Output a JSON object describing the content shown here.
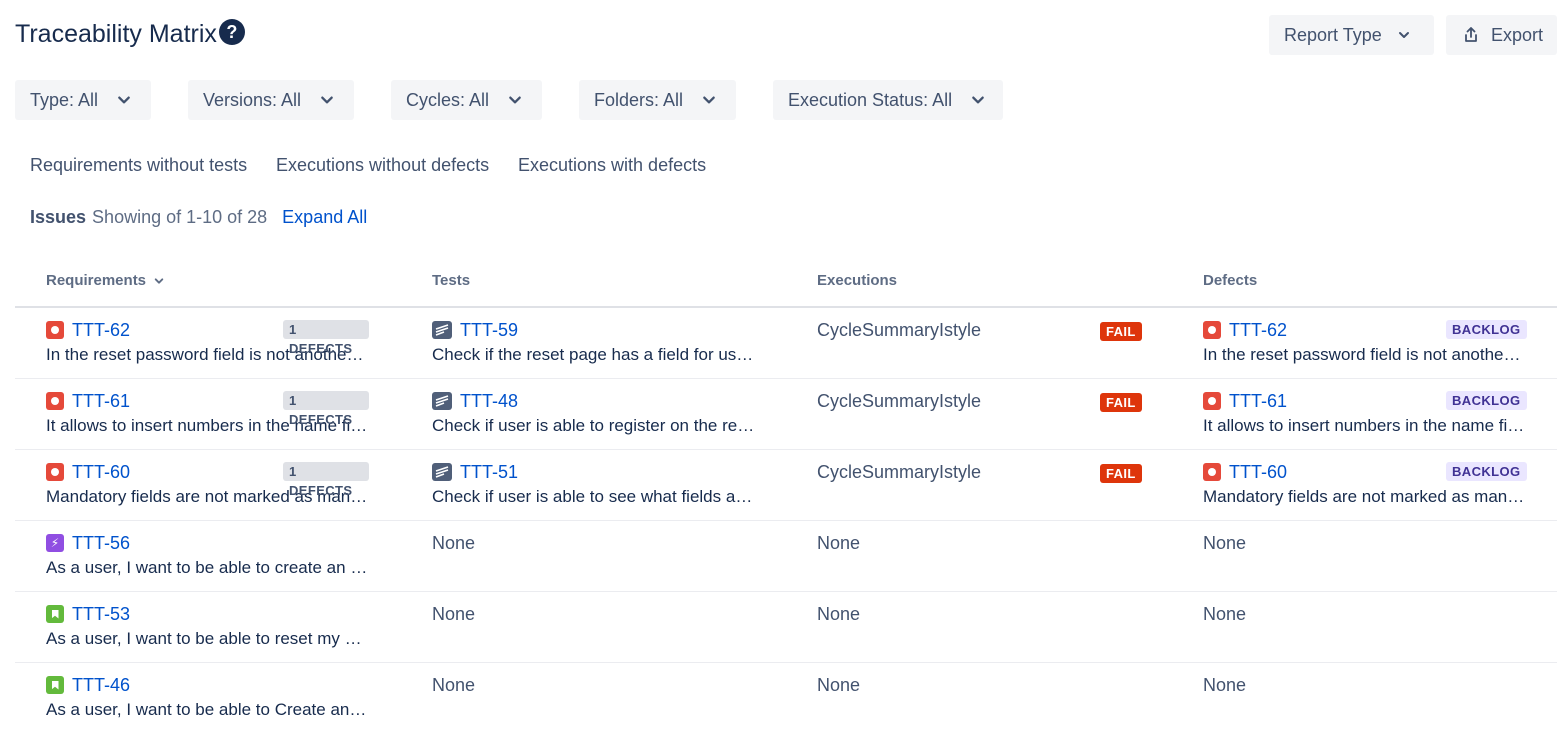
{
  "header": {
    "title": "Traceability Matrix",
    "help_glyph": "?",
    "report_type_label": "Report Type",
    "export_label": "Export"
  },
  "filters": [
    {
      "label": "Type: All"
    },
    {
      "label": "Versions: All"
    },
    {
      "label": "Cycles: All"
    },
    {
      "label": "Folders: All"
    },
    {
      "label": "Execution Status: All"
    }
  ],
  "quick_filters": [
    {
      "label": "Requirements without tests"
    },
    {
      "label": "Executions without defects"
    },
    {
      "label": "Executions with defects"
    }
  ],
  "issues": {
    "label": "Issues",
    "count": "Showing of 1-10 of 28",
    "expand_all": "Expand All"
  },
  "columns": {
    "requirements": "Requirements",
    "tests": "Tests",
    "executions": "Executions",
    "defects": "Defects"
  },
  "colors": {
    "bug": "#e5493a",
    "epic": "#904ee2",
    "story": "#63ba3c",
    "test": "#505f79",
    "link": "#0052cc",
    "fail": "#de350b",
    "backlog_bg": "#eae6ff"
  },
  "rows": [
    {
      "req": {
        "key": "TTT-62",
        "icon": "bug-icon",
        "summary": "In the reset password field is not another field to confirm the password",
        "badge": "1 DEFECTS"
      },
      "test": {
        "key": "TTT-59",
        "icon": "test-icon",
        "summary": "Check if the reset page has a field for user to confirm the password"
      },
      "execution": {
        "name": "CycleSummaryIstyle",
        "status": "FAIL"
      },
      "defect": {
        "key": "TTT-62",
        "icon": "bug-icon",
        "summary": "In the reset password field is not another field to confirm the password",
        "status": "BACKLOG"
      }
    },
    {
      "req": {
        "key": "TTT-61",
        "icon": "bug-icon",
        "summary": "It allows to insert numbers in the name field of the registration page",
        "badge": "1 DEFECTS"
      },
      "test": {
        "key": "TTT-48",
        "icon": "test-icon",
        "summary": "Check if user is able to register on the registration page"
      },
      "execution": {
        "name": "CycleSummaryIstyle",
        "status": "FAIL"
      },
      "defect": {
        "key": "TTT-61",
        "icon": "bug-icon",
        "summary": "It allows to insert numbers in the name field of the registration page",
        "status": "BACKLOG"
      }
    },
    {
      "req": {
        "key": "TTT-60",
        "icon": "bug-icon",
        "summary": "Mandatory fields are not marked as mandatory on the form",
        "badge": "1 DEFECTS"
      },
      "test": {
        "key": "TTT-51",
        "icon": "test-icon",
        "summary": "Check if user is able to see what fields are mandatory"
      },
      "execution": {
        "name": "CycleSummaryIstyle",
        "status": "FAIL"
      },
      "defect": {
        "key": "TTT-60",
        "icon": "bug-icon",
        "summary": "Mandatory fields are not marked as mandatory on the form",
        "status": "BACKLOG"
      }
    },
    {
      "req": {
        "key": "TTT-56",
        "icon": "epic-icon",
        "summary": "As a user, I want to be able to create an account"
      },
      "test": {
        "none": "None"
      },
      "execution": {
        "none": "None"
      },
      "defect": {
        "none": "None"
      }
    },
    {
      "req": {
        "key": "TTT-53",
        "icon": "story-icon",
        "summary": "As a user, I want to be able to reset my password"
      },
      "test": {
        "none": "None"
      },
      "execution": {
        "none": "None"
      },
      "defect": {
        "none": "None"
      }
    },
    {
      "req": {
        "key": "TTT-46",
        "icon": "story-icon",
        "summary": "As a user, I want to be able to Create an account"
      },
      "test": {
        "none": "None"
      },
      "execution": {
        "none": "None"
      },
      "defect": {
        "none": "None"
      }
    }
  ]
}
